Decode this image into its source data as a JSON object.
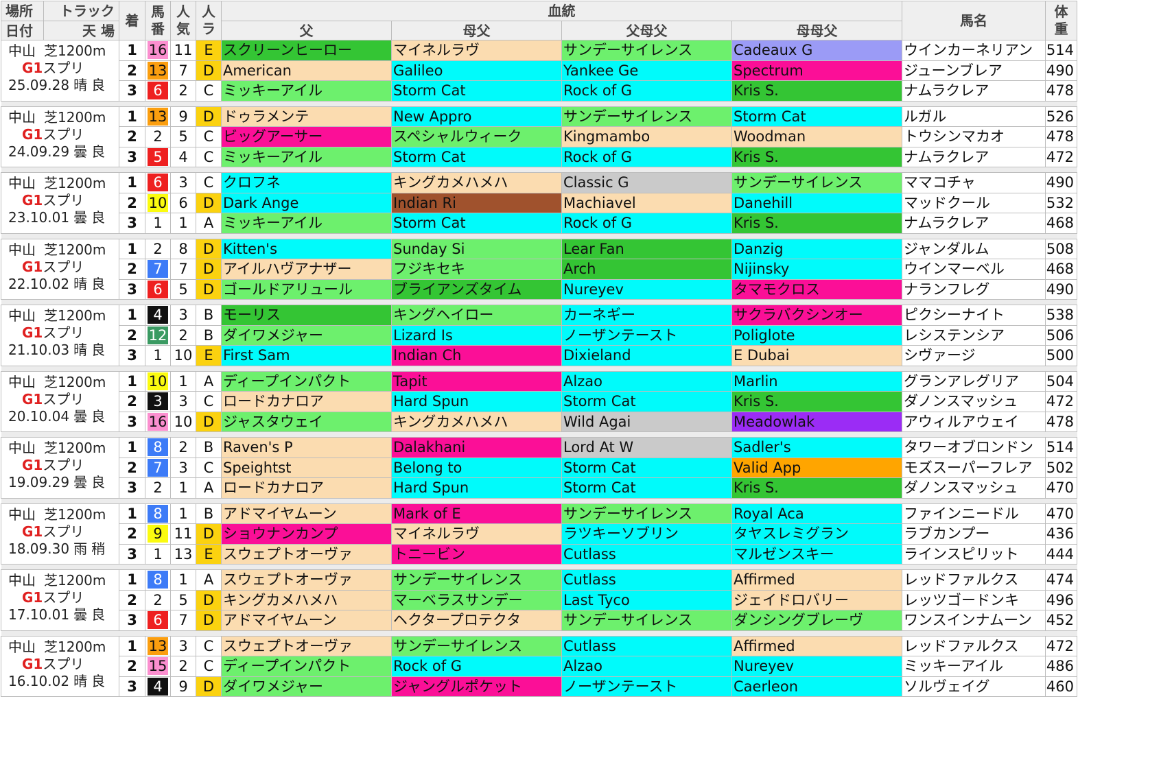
{
  "header": {
    "venue": "場所",
    "track": "トラック",
    "date": "日付",
    "weather_going": "天 場",
    "finish": "着",
    "gate_no": "馬\n番",
    "popularity": "人\n気",
    "pop_rank": "人\nラ",
    "pedigree": "血統",
    "sire": "父",
    "dam_sire": "母父",
    "sire_sire": "父母父",
    "dam_dam_sire": "母母父",
    "horse_name": "馬名",
    "weight": "体\n重"
  },
  "colors": {
    "green": "#34c534",
    "lime": "#6df06d",
    "peach": "#fbdcb0",
    "cyan": "#00fbfb",
    "pink": "#fb0f97",
    "periwinkle": "#9b9bf6",
    "grey": "#cacaca",
    "brown": "#a0522d",
    "purple": "#9b2cf5",
    "orange": "#ffa500",
    "badge_pink": "#fb8fcf",
    "badge_orange": "#fb9e0f",
    "badge_red": "#ee2020",
    "badge_yellow": "#fbfb10",
    "badge_blue": "#3d7bf7",
    "badge_black": "#111111",
    "badge_teal": "#3a9a62",
    "rank_yellow": "#fbd20f"
  },
  "races": [
    {
      "venue": "中山",
      "track": "芝1200m",
      "grade": "G1",
      "race": "スプリ",
      "date": "25.09.28",
      "weather": "晴",
      "going": "良",
      "rows": [
        {
          "pos": "1",
          "num": "16",
          "num_bg": "#fb8fcf",
          "num_fg": "#111",
          "pop": "11",
          "rank": "E",
          "rank_bg": "#fbd20f",
          "sire": "スクリーンヒーロー",
          "sire_bg": "#34c534",
          "ds": "マイネルラヴ",
          "ds_bg": "#fbdcb0",
          "ss": "サンデーサイレンス",
          "ss_bg": "#6df06d",
          "dds": "Cadeaux G",
          "dds_bg": "#9b9bf6",
          "name": "ウインカーネリアン",
          "wt": "514"
        },
        {
          "pos": "2",
          "num": "13",
          "num_bg": "#fb9e0f",
          "num_fg": "#111",
          "pop": "7",
          "rank": "D",
          "rank_bg": "#fbd20f",
          "sire": "American",
          "sire_bg": "#fbdcb0",
          "ds": "Galileo",
          "ds_bg": "#00fbfb",
          "ss": "Yankee Ge",
          "ss_bg": "#00fbfb",
          "dds": "Spectrum",
          "dds_bg": "#fb0f97",
          "name": "ジューンブレア",
          "wt": "490"
        },
        {
          "pos": "3",
          "num": "6",
          "num_bg": "#ee2020",
          "num_fg": "#fff",
          "pop": "2",
          "rank": "C",
          "rank_bg": "#fff",
          "sire": "ミッキーアイル",
          "sire_bg": "#6df06d",
          "ds": "Storm Cat",
          "ds_bg": "#00fbfb",
          "ss": "Rock of G",
          "ss_bg": "#00fbfb",
          "dds": "Kris S.",
          "dds_bg": "#34c534",
          "name": "ナムラクレア",
          "wt": "478"
        }
      ]
    },
    {
      "venue": "中山",
      "track": "芝1200m",
      "grade": "G1",
      "race": "スプリ",
      "date": "24.09.29",
      "weather": "曇",
      "going": "良",
      "rows": [
        {
          "pos": "1",
          "num": "13",
          "num_bg": "#fb9e0f",
          "num_fg": "#111",
          "pop": "9",
          "rank": "D",
          "rank_bg": "#fbd20f",
          "sire": "ドゥラメンテ",
          "sire_bg": "#fbdcb0",
          "ds": "New Appro",
          "ds_bg": "#00fbfb",
          "ss": "サンデーサイレンス",
          "ss_bg": "#6df06d",
          "dds": "Storm Cat",
          "dds_bg": "#00fbfb",
          "name": "ルガル",
          "wt": "526"
        },
        {
          "pos": "2",
          "num": "2",
          "num_bg": "#fff",
          "num_fg": "#111",
          "pop": "5",
          "rank": "C",
          "rank_bg": "#fff",
          "sire": "ビッグアーサー",
          "sire_bg": "#fb0f97",
          "ds": "スペシャルウィーク",
          "ds_bg": "#6df06d",
          "ss": "Kingmambo",
          "ss_bg": "#fbdcb0",
          "dds": "Woodman",
          "dds_bg": "#fbdcb0",
          "name": "トウシンマカオ",
          "wt": "478"
        },
        {
          "pos": "3",
          "num": "5",
          "num_bg": "#ee2020",
          "num_fg": "#fff",
          "pop": "4",
          "rank": "C",
          "rank_bg": "#fff",
          "sire": "ミッキーアイル",
          "sire_bg": "#6df06d",
          "ds": "Storm Cat",
          "ds_bg": "#00fbfb",
          "ss": "Rock of G",
          "ss_bg": "#00fbfb",
          "dds": "Kris S.",
          "dds_bg": "#34c534",
          "name": "ナムラクレア",
          "wt": "472"
        }
      ]
    },
    {
      "venue": "中山",
      "track": "芝1200m",
      "grade": "G1",
      "race": "スプリ",
      "date": "23.10.01",
      "weather": "曇",
      "going": "良",
      "rows": [
        {
          "pos": "1",
          "num": "6",
          "num_bg": "#ee2020",
          "num_fg": "#fff",
          "pop": "3",
          "rank": "C",
          "rank_bg": "#fff",
          "sire": "クロフネ",
          "sire_bg": "#00fbfb",
          "ds": "キングカメハメハ",
          "ds_bg": "#fbdcb0",
          "ss": "Classic G",
          "ss_bg": "#cacaca",
          "dds": "サンデーサイレンス",
          "dds_bg": "#6df06d",
          "name": "ママコチャ",
          "wt": "490"
        },
        {
          "pos": "2",
          "num": "10",
          "num_bg": "#fbfb10",
          "num_fg": "#111",
          "pop": "6",
          "rank": "D",
          "rank_bg": "#fbd20f",
          "sire": "Dark Ange",
          "sire_bg": "#00fbfb",
          "ds": "Indian Ri",
          "ds_bg": "#a0522d",
          "ss": "Machiavel",
          "ss_bg": "#fbdcb0",
          "dds": "Danehill",
          "dds_bg": "#00fbfb",
          "name": "マッドクール",
          "wt": "532"
        },
        {
          "pos": "3",
          "num": "1",
          "num_bg": "#fff",
          "num_fg": "#111",
          "pop": "1",
          "rank": "A",
          "rank_bg": "#fff",
          "sire": "ミッキーアイル",
          "sire_bg": "#6df06d",
          "ds": "Storm Cat",
          "ds_bg": "#00fbfb",
          "ss": "Rock of G",
          "ss_bg": "#00fbfb",
          "dds": "Kris S.",
          "dds_bg": "#34c534",
          "name": "ナムラクレア",
          "wt": "468"
        }
      ]
    },
    {
      "venue": "中山",
      "track": "芝1200m",
      "grade": "G1",
      "race": "スプリ",
      "date": "22.10.02",
      "weather": "晴",
      "going": "良",
      "rows": [
        {
          "pos": "1",
          "num": "2",
          "num_bg": "#fff",
          "num_fg": "#111",
          "pop": "8",
          "rank": "D",
          "rank_bg": "#fbd20f",
          "sire": "Kitten's",
          "sire_bg": "#00fbfb",
          "ds": "Sunday Si",
          "ds_bg": "#6df06d",
          "ss": "Lear Fan",
          "ss_bg": "#34c534",
          "dds": "Danzig",
          "dds_bg": "#00fbfb",
          "name": "ジャンダルム",
          "wt": "508"
        },
        {
          "pos": "2",
          "num": "7",
          "num_bg": "#3d7bf7",
          "num_fg": "#fff",
          "pop": "7",
          "rank": "D",
          "rank_bg": "#fbd20f",
          "sire": "アイルハヴアナザー",
          "sire_bg": "#fbdcb0",
          "ds": "フジキセキ",
          "ds_bg": "#6df06d",
          "ss": "Arch",
          "ss_bg": "#34c534",
          "dds": "Nijinsky",
          "dds_bg": "#00fbfb",
          "name": "ウインマーベル",
          "wt": "468"
        },
        {
          "pos": "3",
          "num": "6",
          "num_bg": "#ee2020",
          "num_fg": "#fff",
          "pop": "5",
          "rank": "D",
          "rank_bg": "#fbd20f",
          "sire": "ゴールドアリュール",
          "sire_bg": "#6df06d",
          "ds": "ブライアンズタイム",
          "ds_bg": "#34c534",
          "ss": "Nureyev",
          "ss_bg": "#00fbfb",
          "dds": "タマモクロス",
          "dds_bg": "#fb0f97",
          "name": "ナランフレグ",
          "wt": "490"
        }
      ]
    },
    {
      "venue": "中山",
      "track": "芝1200m",
      "grade": "G1",
      "race": "スプリ",
      "date": "21.10.03",
      "weather": "晴",
      "going": "良",
      "rows": [
        {
          "pos": "1",
          "num": "4",
          "num_bg": "#111111",
          "num_fg": "#fff",
          "pop": "3",
          "rank": "B",
          "rank_bg": "#fff",
          "sire": "モーリス",
          "sire_bg": "#34c534",
          "ds": "キングヘイロー",
          "ds_bg": "#6df06d",
          "ss": "カーネギー",
          "ss_bg": "#00fbfb",
          "dds": "サクラバクシンオー",
          "dds_bg": "#fb0f97",
          "name": "ピクシーナイト",
          "wt": "538"
        },
        {
          "pos": "2",
          "num": "12",
          "num_bg": "#3a9a62",
          "num_fg": "#fff",
          "pop": "2",
          "rank": "B",
          "rank_bg": "#fff",
          "sire": "ダイワメジャー",
          "sire_bg": "#6df06d",
          "ds": "Lizard Is",
          "ds_bg": "#00fbfb",
          "ss": "ノーザンテースト",
          "ss_bg": "#00fbfb",
          "dds": "Poliglote",
          "dds_bg": "#00fbfb",
          "name": "レシステンシア",
          "wt": "506"
        },
        {
          "pos": "3",
          "num": "1",
          "num_bg": "#fff",
          "num_fg": "#111",
          "pop": "10",
          "rank": "E",
          "rank_bg": "#fbd20f",
          "sire": "First Sam",
          "sire_bg": "#00fbfb",
          "ds": "Indian Ch",
          "ds_bg": "#fb0f97",
          "ss": "Dixieland",
          "ss_bg": "#00fbfb",
          "dds": "E Dubai",
          "dds_bg": "#fbdcb0",
          "name": "シヴァージ",
          "wt": "500"
        }
      ]
    },
    {
      "venue": "中山",
      "track": "芝1200m",
      "grade": "G1",
      "race": "スプリ",
      "date": "20.10.04",
      "weather": "曇",
      "going": "良",
      "rows": [
        {
          "pos": "1",
          "num": "10",
          "num_bg": "#fbfb10",
          "num_fg": "#111",
          "pop": "1",
          "rank": "A",
          "rank_bg": "#fff",
          "sire": "ディープインパクト",
          "sire_bg": "#6df06d",
          "ds": "Tapit",
          "ds_bg": "#fb0f97",
          "ss": "Alzao",
          "ss_bg": "#00fbfb",
          "dds": "Marlin",
          "dds_bg": "#00fbfb",
          "name": "グランアレグリア",
          "wt": "504"
        },
        {
          "pos": "2",
          "num": "3",
          "num_bg": "#111111",
          "num_fg": "#fff",
          "pop": "3",
          "rank": "C",
          "rank_bg": "#fff",
          "sire": "ロードカナロア",
          "sire_bg": "#fbdcb0",
          "ds": "Hard Spun",
          "ds_bg": "#00fbfb",
          "ss": "Storm Cat",
          "ss_bg": "#00fbfb",
          "dds": "Kris S.",
          "dds_bg": "#34c534",
          "name": "ダノンスマッシュ",
          "wt": "472"
        },
        {
          "pos": "3",
          "num": "16",
          "num_bg": "#fb8fcf",
          "num_fg": "#111",
          "pop": "10",
          "rank": "D",
          "rank_bg": "#fbd20f",
          "sire": "ジャスタウェイ",
          "sire_bg": "#6df06d",
          "ds": "キングカメハメハ",
          "ds_bg": "#fbdcb0",
          "ss": "Wild Agai",
          "ss_bg": "#cacaca",
          "dds": "Meadowlak",
          "dds_bg": "#9b2cf5",
          "name": "アウィルアウェイ",
          "wt": "478"
        }
      ]
    },
    {
      "venue": "中山",
      "track": "芝1200m",
      "grade": "G1",
      "race": "スプリ",
      "date": "19.09.29",
      "weather": "曇",
      "going": "良",
      "rows": [
        {
          "pos": "1",
          "num": "8",
          "num_bg": "#3d7bf7",
          "num_fg": "#fff",
          "pop": "2",
          "rank": "B",
          "rank_bg": "#fff",
          "sire": "Raven's P",
          "sire_bg": "#fbdcb0",
          "ds": "Dalakhani",
          "ds_bg": "#fb0f97",
          "ss": "Lord At W",
          "ss_bg": "#cacaca",
          "dds": "Sadler's",
          "dds_bg": "#00fbfb",
          "name": "タワーオブロンドン",
          "wt": "514"
        },
        {
          "pos": "2",
          "num": "7",
          "num_bg": "#3d7bf7",
          "num_fg": "#fff",
          "pop": "3",
          "rank": "C",
          "rank_bg": "#fff",
          "sire": "Speightst",
          "sire_bg": "#fbdcb0",
          "ds": "Belong to",
          "ds_bg": "#00fbfb",
          "ss": "Storm Cat",
          "ss_bg": "#00fbfb",
          "dds": "Valid App",
          "dds_bg": "#ffa500",
          "name": "モズスーパーフレア",
          "wt": "502"
        },
        {
          "pos": "3",
          "num": "2",
          "num_bg": "#fff",
          "num_fg": "#111",
          "pop": "1",
          "rank": "A",
          "rank_bg": "#fff",
          "sire": "ロードカナロア",
          "sire_bg": "#fbdcb0",
          "ds": "Hard Spun",
          "ds_bg": "#00fbfb",
          "ss": "Storm Cat",
          "ss_bg": "#00fbfb",
          "dds": "Kris S.",
          "dds_bg": "#34c534",
          "name": "ダノンスマッシュ",
          "wt": "470"
        }
      ]
    },
    {
      "venue": "中山",
      "track": "芝1200m",
      "grade": "G1",
      "race": "スプリ",
      "date": "18.09.30",
      "weather": "雨",
      "going": "稍",
      "rows": [
        {
          "pos": "1",
          "num": "8",
          "num_bg": "#3d7bf7",
          "num_fg": "#fff",
          "pop": "1",
          "rank": "B",
          "rank_bg": "#fff",
          "sire": "アドマイヤムーン",
          "sire_bg": "#fbdcb0",
          "ds": "Mark of E",
          "ds_bg": "#fb0f97",
          "ss": "サンデーサイレンス",
          "ss_bg": "#6df06d",
          "dds": "Royal Aca",
          "dds_bg": "#00fbfb",
          "name": "ファインニードル",
          "wt": "470"
        },
        {
          "pos": "2",
          "num": "9",
          "num_bg": "#fbfb10",
          "num_fg": "#111",
          "pop": "11",
          "rank": "D",
          "rank_bg": "#fbd20f",
          "sire": "ショウナンカンプ",
          "sire_bg": "#fb0f97",
          "ds": "マイネルラヴ",
          "ds_bg": "#fbdcb0",
          "ss": "ラツキーソブリン",
          "ss_bg": "#00fbfb",
          "dds": "タヤスレミグラン",
          "dds_bg": "#00fbfb",
          "name": "ラブカンプー",
          "wt": "436"
        },
        {
          "pos": "3",
          "num": "1",
          "num_bg": "#fff",
          "num_fg": "#111",
          "pop": "13",
          "rank": "E",
          "rank_bg": "#fbd20f",
          "sire": "スウェプトオーヴァ",
          "sire_bg": "#fbdcb0",
          "ds": "トニービン",
          "ds_bg": "#fb0f97",
          "ss": "Cutlass",
          "ss_bg": "#00fbfb",
          "dds": "マルゼンスキー",
          "dds_bg": "#00fbfb",
          "name": "ラインスピリット",
          "wt": "444"
        }
      ]
    },
    {
      "venue": "中山",
      "track": "芝1200m",
      "grade": "G1",
      "race": "スプリ",
      "date": "17.10.01",
      "weather": "曇",
      "going": "良",
      "rows": [
        {
          "pos": "1",
          "num": "8",
          "num_bg": "#3d7bf7",
          "num_fg": "#fff",
          "pop": "1",
          "rank": "A",
          "rank_bg": "#fff",
          "sire": "スウェプトオーヴァ",
          "sire_bg": "#fbdcb0",
          "ds": "サンデーサイレンス",
          "ds_bg": "#6df06d",
          "ss": "Cutlass",
          "ss_bg": "#00fbfb",
          "dds": "Affirmed",
          "dds_bg": "#fbdcb0",
          "name": "レッドファルクス",
          "wt": "474"
        },
        {
          "pos": "2",
          "num": "2",
          "num_bg": "#fff",
          "num_fg": "#111",
          "pop": "5",
          "rank": "D",
          "rank_bg": "#fbd20f",
          "sire": "キングカメハメハ",
          "sire_bg": "#fbdcb0",
          "ds": "マーベラスサンデー",
          "ds_bg": "#6df06d",
          "ss": "Last Tyco",
          "ss_bg": "#00fbfb",
          "dds": "ジェイドロバリー",
          "dds_bg": "#fbdcb0",
          "name": "レッツゴードンキ",
          "wt": "496"
        },
        {
          "pos": "3",
          "num": "6",
          "num_bg": "#ee2020",
          "num_fg": "#fff",
          "pop": "7",
          "rank": "D",
          "rank_bg": "#fbd20f",
          "sire": "アドマイヤムーン",
          "sire_bg": "#fbdcb0",
          "ds": "ヘクタープロテクタ",
          "ds_bg": "#fbdcb0",
          "ss": "サンデーサイレンス",
          "ss_bg": "#6df06d",
          "dds": "ダンシングブレーヴ",
          "dds_bg": "#6df06d",
          "name": "ワンスインナムーン",
          "wt": "452"
        }
      ]
    },
    {
      "venue": "中山",
      "track": "芝1200m",
      "grade": "G1",
      "race": "スプリ",
      "date": "16.10.02",
      "weather": "晴",
      "going": "良",
      "rows": [
        {
          "pos": "1",
          "num": "13",
          "num_bg": "#fb9e0f",
          "num_fg": "#111",
          "pop": "3",
          "rank": "C",
          "rank_bg": "#fff",
          "sire": "スウェプトオーヴァ",
          "sire_bg": "#fbdcb0",
          "ds": "サンデーサイレンス",
          "ds_bg": "#6df06d",
          "ss": "Cutlass",
          "ss_bg": "#00fbfb",
          "dds": "Affirmed",
          "dds_bg": "#fbdcb0",
          "name": "レッドファルクス",
          "wt": "472"
        },
        {
          "pos": "2",
          "num": "15",
          "num_bg": "#fb8fcf",
          "num_fg": "#111",
          "pop": "2",
          "rank": "C",
          "rank_bg": "#fff",
          "sire": "ディープインパクト",
          "sire_bg": "#6df06d",
          "ds": "Rock of G",
          "ds_bg": "#00fbfb",
          "ss": "Alzao",
          "ss_bg": "#00fbfb",
          "dds": "Nureyev",
          "dds_bg": "#00fbfb",
          "name": "ミッキーアイル",
          "wt": "486"
        },
        {
          "pos": "3",
          "num": "4",
          "num_bg": "#111111",
          "num_fg": "#fff",
          "pop": "9",
          "rank": "D",
          "rank_bg": "#fbd20f",
          "sire": "ダイワメジャー",
          "sire_bg": "#6df06d",
          "ds": "ジャングルポケット",
          "ds_bg": "#fb0f97",
          "ss": "ノーザンテースト",
          "ss_bg": "#00fbfb",
          "dds": "Caerleon",
          "dds_bg": "#00fbfb",
          "name": "ソルヴェイグ",
          "wt": "460"
        }
      ]
    }
  ]
}
